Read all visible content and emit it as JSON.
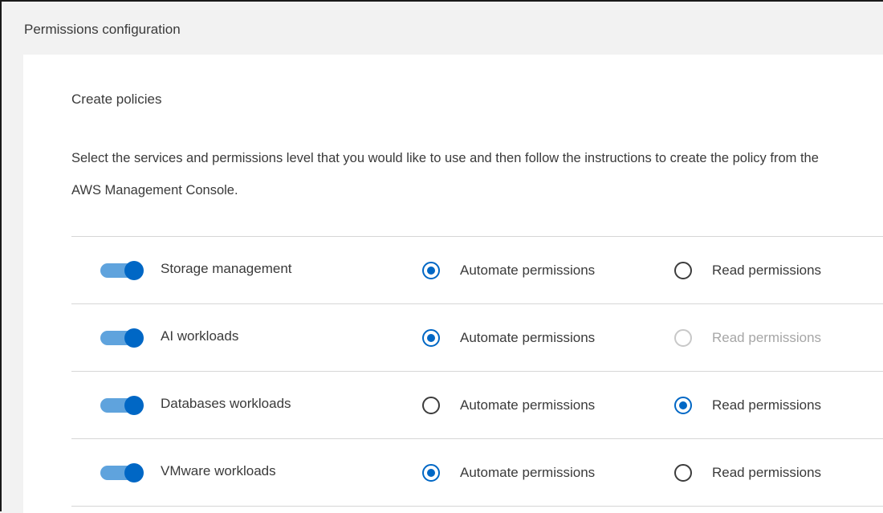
{
  "header": {
    "title": "Permissions configuration"
  },
  "section": {
    "title": "Create policies",
    "description": "Select the services and permissions level that you would like to use and then follow the instructions to create the policy from the AWS Management Console."
  },
  "colors": {
    "accent": "#0067c5",
    "toggle_track": "#5fa3dd",
    "disabled": "#c8c8c8"
  },
  "services": [
    {
      "name": "Storage management",
      "enabled": true,
      "selected": "automate",
      "read_disabled": false,
      "automate_label": "Automate permissions",
      "read_label": "Read permissions"
    },
    {
      "name": "AI workloads",
      "enabled": true,
      "selected": "automate",
      "read_disabled": true,
      "automate_label": "Automate permissions",
      "read_label": "Read permissions"
    },
    {
      "name": "Databases workloads",
      "enabled": true,
      "selected": "read",
      "read_disabled": false,
      "automate_label": "Automate permissions",
      "read_label": "Read permissions"
    },
    {
      "name": "VMware workloads",
      "enabled": true,
      "selected": "automate",
      "read_disabled": false,
      "automate_label": "Automate permissions",
      "read_label": "Read permissions"
    }
  ]
}
